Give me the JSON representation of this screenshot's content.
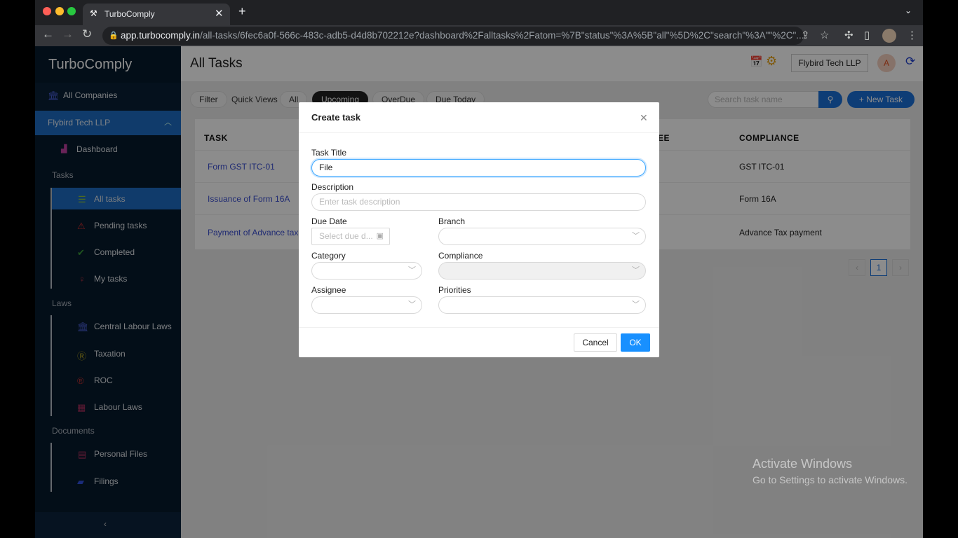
{
  "browser": {
    "tab_title": "TurboComply",
    "url_domain": "app.turbocomply.in",
    "url_path": "/all-tasks/6fec6a0f-566c-483c-adb5-d4d8b702212e?dashboard%2Falltasks%2Fatom=%7B\"status\"%3A%5B\"all\"%5D%2C\"search\"%3A\"\"%2C\"..."
  },
  "sidebar": {
    "brand": "TurboComply",
    "all_companies": "All Companies",
    "company": "Flybird Tech LLP",
    "dashboard": "Dashboard",
    "sections": {
      "tasks": "Tasks",
      "laws": "Laws",
      "documents": "Documents"
    },
    "tasks": [
      {
        "label": "All tasks",
        "icon": "list-icon",
        "active": true
      },
      {
        "label": "Pending tasks",
        "icon": "warning-icon"
      },
      {
        "label": "Completed",
        "icon": "check-circle-icon"
      },
      {
        "label": "My tasks",
        "icon": "user-icon"
      }
    ],
    "laws": [
      {
        "label": "Central Labour Laws",
        "icon": "bank-icon"
      },
      {
        "label": "Taxation",
        "icon": "rupee-icon"
      },
      {
        "label": "ROC",
        "icon": "registered-icon"
      },
      {
        "label": "Labour Laws",
        "icon": "building-icon"
      }
    ],
    "documents": [
      {
        "label": "Personal Files",
        "icon": "file-icon"
      },
      {
        "label": "Filings",
        "icon": "folder-icon"
      }
    ]
  },
  "header": {
    "title": "All Tasks",
    "company_button": "Flybird Tech LLP",
    "avatar": "A"
  },
  "filters": {
    "filter": "Filter",
    "quick_views": "Quick Views",
    "all": "All",
    "upcoming": "Upcoming",
    "overdue": "OverDue",
    "due_today": "Due Today",
    "search_placeholder": "Search task name",
    "new_task": "+ New Task"
  },
  "table": {
    "columns": {
      "task": "TASK",
      "assignee": "EE",
      "compliance": "COMPLIANCE"
    },
    "rows": [
      {
        "task": "Form GST ITC-01",
        "compliance": "GST ITC-01"
      },
      {
        "task": "Issuance of Form 16A",
        "compliance": "Form 16A"
      },
      {
        "task": "Payment of Advance tax",
        "compliance": "Advance Tax payment"
      }
    ],
    "page": "1"
  },
  "modal": {
    "title": "Create task",
    "task_title_label": "Task Title",
    "task_title_value": "File",
    "description_label": "Description",
    "description_placeholder": "Enter task description",
    "due_date_label": "Due Date",
    "due_date_placeholder": "Select due d...",
    "branch_label": "Branch",
    "category_label": "Category",
    "compliance_label": "Compliance",
    "assignee_label": "Assignee",
    "priorities_label": "Priorities",
    "cancel": "Cancel",
    "ok": "OK"
  },
  "watermark": {
    "line1": "Activate Windows",
    "line2": "Go to Settings to activate Windows."
  },
  "colors": {
    "primary": "#1890ff",
    "sidebar": "#001529"
  }
}
